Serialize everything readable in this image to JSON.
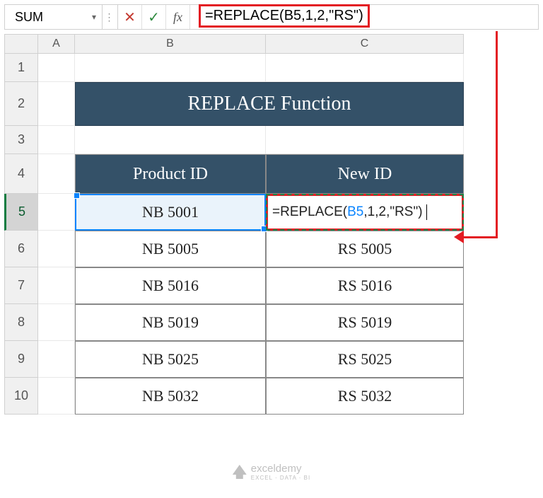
{
  "nameBox": "SUM",
  "formulaBar": "=REPLACE(B5,1,2,\"RS\")",
  "columns": [
    "A",
    "B",
    "C"
  ],
  "rows": [
    "1",
    "2",
    "3",
    "4",
    "5",
    "6",
    "7",
    "8",
    "9",
    "10"
  ],
  "title": "REPLACE Function",
  "headers": {
    "b": "Product ID",
    "c": "New ID"
  },
  "editCell": {
    "prefix": "=REPLACE(",
    "ref": "B5",
    "suffix": ",1,2,\"RS\")"
  },
  "data": {
    "b5": "NB 5001",
    "b6": "NB 5005",
    "c6": "RS 5005",
    "b7": "NB 5016",
    "c7": "RS 5016",
    "b8": "NB 5019",
    "c8": "RS 5019",
    "b9": "NB 5025",
    "c9": "RS 5025",
    "b10": "NB 5032",
    "c10": "RS 5032"
  },
  "watermark": {
    "name": "exceldemy",
    "tag": "EXCEL · DATA · BI"
  }
}
